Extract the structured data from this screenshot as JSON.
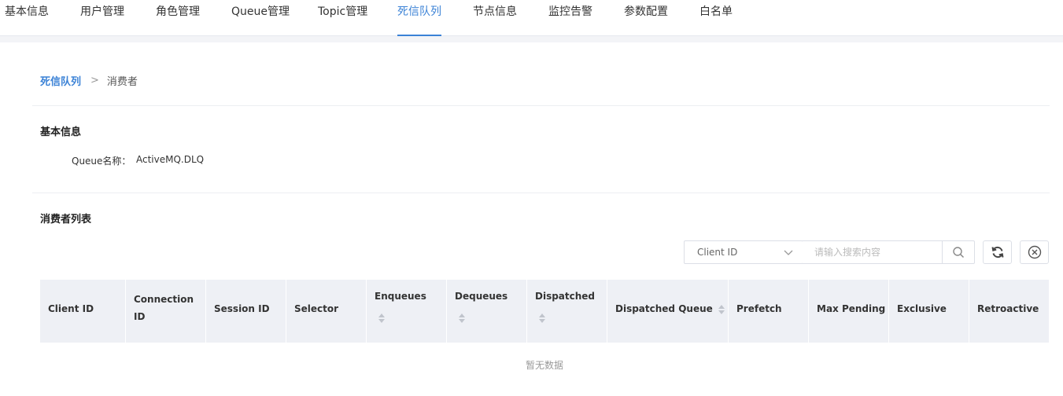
{
  "tabs": [
    {
      "label": "基本信息",
      "active": false
    },
    {
      "label": "用户管理",
      "active": false
    },
    {
      "label": "角色管理",
      "active": false
    },
    {
      "label": "Queue管理",
      "active": false
    },
    {
      "label": "Topic管理",
      "active": false
    },
    {
      "label": "死信队列",
      "active": true
    },
    {
      "label": "节点信息",
      "active": false
    },
    {
      "label": "监控告警",
      "active": false
    },
    {
      "label": "参数配置",
      "active": false
    },
    {
      "label": "白名单",
      "active": false
    }
  ],
  "breadcrumb": {
    "parent": "死信队列",
    "separator": ">",
    "current": "消费者"
  },
  "basic_info": {
    "title": "基本信息",
    "queue_label": "Queue名称：",
    "queue_value": "ActiveMQ.DLQ"
  },
  "consumers": {
    "title": "消费者列表",
    "filter_select": {
      "value": "Client ID",
      "icon": "chevron-down-icon"
    },
    "search_placeholder": "请输入搜索内容",
    "search_icon": "search-icon",
    "refresh_icon": "refresh-icon",
    "clear_icon": "clear-circle-icon",
    "columns": [
      {
        "label": "Client ID",
        "sortable": false
      },
      {
        "label": "Connection ID",
        "sortable": false
      },
      {
        "label": "Session ID",
        "sortable": false
      },
      {
        "label": "Selector",
        "sortable": false
      },
      {
        "label": "Enqueues",
        "sortable": true
      },
      {
        "label": "Dequeues",
        "sortable": true
      },
      {
        "label": "Dispatched",
        "sortable": true
      },
      {
        "label": "Dispatched Queue",
        "sortable": true
      },
      {
        "label": "Prefetch",
        "sortable": false
      },
      {
        "label": "Max Pending",
        "sortable": false
      },
      {
        "label": "Exclusive",
        "sortable": false
      },
      {
        "label": "Retroactive",
        "sortable": false
      }
    ],
    "rows": [],
    "empty_text": "暂无数据"
  },
  "colors": {
    "accent": "#3b82d6",
    "header_bg": "#eef0f5"
  }
}
